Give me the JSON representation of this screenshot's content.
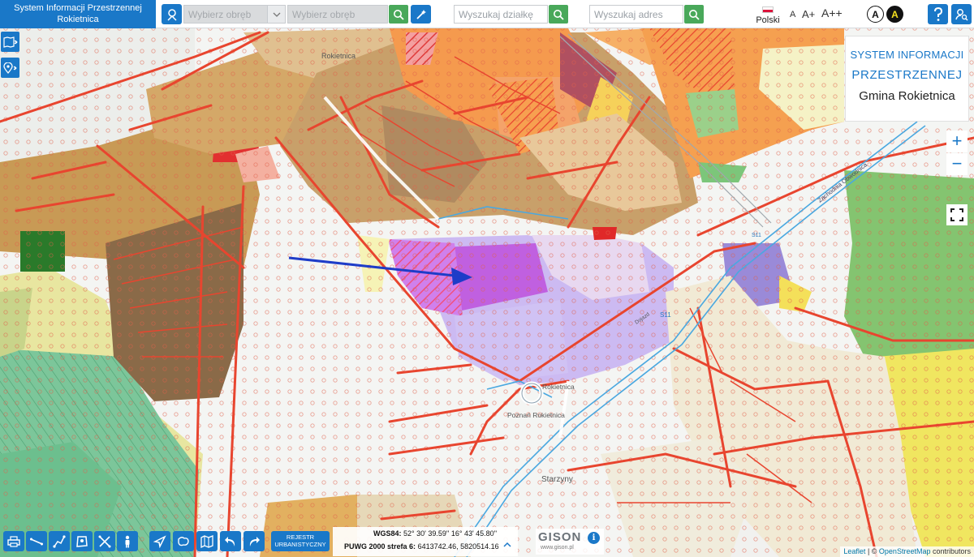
{
  "app": {
    "title_line1": "System Informacji Przestrzennej",
    "title_line2": "Rokietnica"
  },
  "search": {
    "obreb_select_placeholder": "Wybierz obręb",
    "obreb_input_placeholder": "Wybierz obręb",
    "dzialka_placeholder": "Wyszukaj działkę",
    "adres_placeholder": "Wyszukaj adres"
  },
  "language": {
    "label": "Polski"
  },
  "font_size": {
    "small": "A",
    "medium": "A+",
    "large": "A++"
  },
  "contrast": {
    "normal": "A",
    "high": "A"
  },
  "info_box": {
    "line1": "SYSTEM INFORMACJI",
    "line2": "PRZESTRZENNEJ",
    "line3": "Gmina Rokietnica"
  },
  "zoom": {
    "in": "+",
    "out": "−"
  },
  "map_labels": {
    "rokietnica_n": "Rokietnica",
    "rokietnica_center": "Rokietnica",
    "poznan_rokietnica": "Poznań Rokietnica",
    "starzyny": "Starzyny",
    "zachodnia_obwodnica": "Zachodnia Obwodnica",
    "road_s11": "S11",
    "road_s11b": "S11",
    "dzialka": "Dojazd"
  },
  "toolbar": {
    "rejestr_line1": "REJESTR",
    "rejestr_line2": "URBANISTYCZNY"
  },
  "coordinates": {
    "wgs_label": "WGS84:",
    "wgs_value": "52° 30' 39.59'' 16° 43' 45.80''",
    "puwg_label": "PUWG 2000 strefa 6:",
    "puwg_value": "6413742.46, 5820514.16"
  },
  "branding": {
    "logo": "GISON",
    "url": "www.gison.pl"
  },
  "attribution": {
    "leaflet": "Leaflet",
    "separator": " | © ",
    "osm": "OpenStreetMap",
    "suffix": " contributors"
  },
  "colors": {
    "accent": "#1a78c8",
    "search_green": "#49a85a",
    "plan_purple": "#c8a8f0",
    "plan_magenta": "#c060e0",
    "road_red": "#e8452f"
  }
}
